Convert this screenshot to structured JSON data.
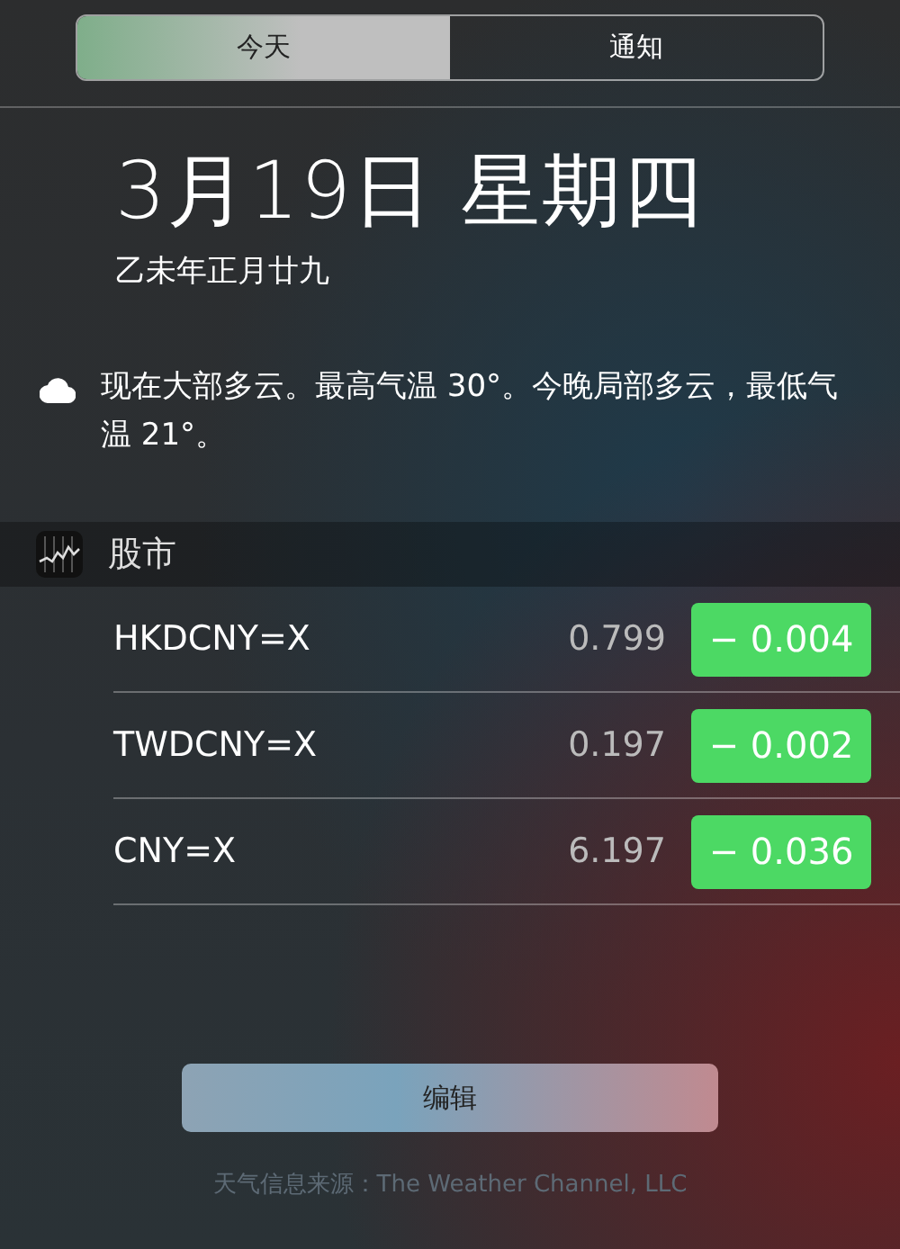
{
  "tabs": [
    {
      "label": "今天",
      "selected": true
    },
    {
      "label": "通知",
      "selected": false
    }
  ],
  "date": {
    "main": "3月19日 星期四",
    "lunar": "乙未年正月廿九"
  },
  "weather": {
    "summary": "现在大部多云。最高气温 30°。今晚局部多云，最低气温 21°。"
  },
  "stocks": {
    "title": "股市",
    "rows": [
      {
        "symbol": "HKDCNY=X",
        "price": "0.799",
        "change": "− 0.004",
        "color": "#4cd964"
      },
      {
        "symbol": "TWDCNY=X",
        "price": "0.197",
        "change": "− 0.002",
        "color": "#4cd964"
      },
      {
        "symbol": "CNY=X",
        "price": "6.197",
        "change": "− 0.036",
        "color": "#4cd964"
      }
    ]
  },
  "edit_button": "编辑",
  "footer": "天气信息来源：The Weather Channel, LLC"
}
